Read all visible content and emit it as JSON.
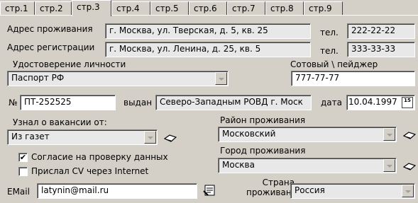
{
  "tabs": [
    "стр.1",
    "стр.2",
    "стр.3",
    "стр.4",
    "стр.5",
    "стр.6",
    "стр.7",
    "стр.8",
    "стр.9"
  ],
  "active_tab": "стр.3",
  "address": {
    "living_label": "Адрес проживания",
    "living_value": "г. Москва, ул. Тверская, д. 5, кв. 25",
    "registration_label": "Адрес регистрации",
    "registration_value": "г. Москва, ул. Ленина, д. 25, кв. 5",
    "phone_label_1": "тел.",
    "phone_value_1": "222-22-22",
    "phone_label_2": "тел.",
    "phone_value_2": "333-33-33"
  },
  "identity": {
    "label": "Удостоверение личности",
    "value": "Паспорт РФ",
    "number_label": "№",
    "number_value": "ПТ-252525",
    "issued_label": "выдан",
    "issued_value": "Северо-Западным РОВД г. Моск",
    "date_label": "дата",
    "date_value": "10.04.1997",
    "calendar_text": "15"
  },
  "mobile": {
    "label": "Сотовый \\ пейджер",
    "value": "777-77-77"
  },
  "vacancy": {
    "label": "Узнал о вакансии от:",
    "value": "Из газет"
  },
  "district": {
    "label": "Район проживания",
    "value": "Московский"
  },
  "city": {
    "label": "Город проживания",
    "value": "Москва"
  },
  "checks": {
    "consent_label": "Согласие на проверку данных",
    "consent_checked": "✔",
    "cv_label": "Прислал CV через Internet"
  },
  "email": {
    "label": "EMail",
    "value": "latynin@mail.ru"
  },
  "country": {
    "label_line1": "Страна",
    "label_line2": "проживания",
    "value": "Россия"
  }
}
